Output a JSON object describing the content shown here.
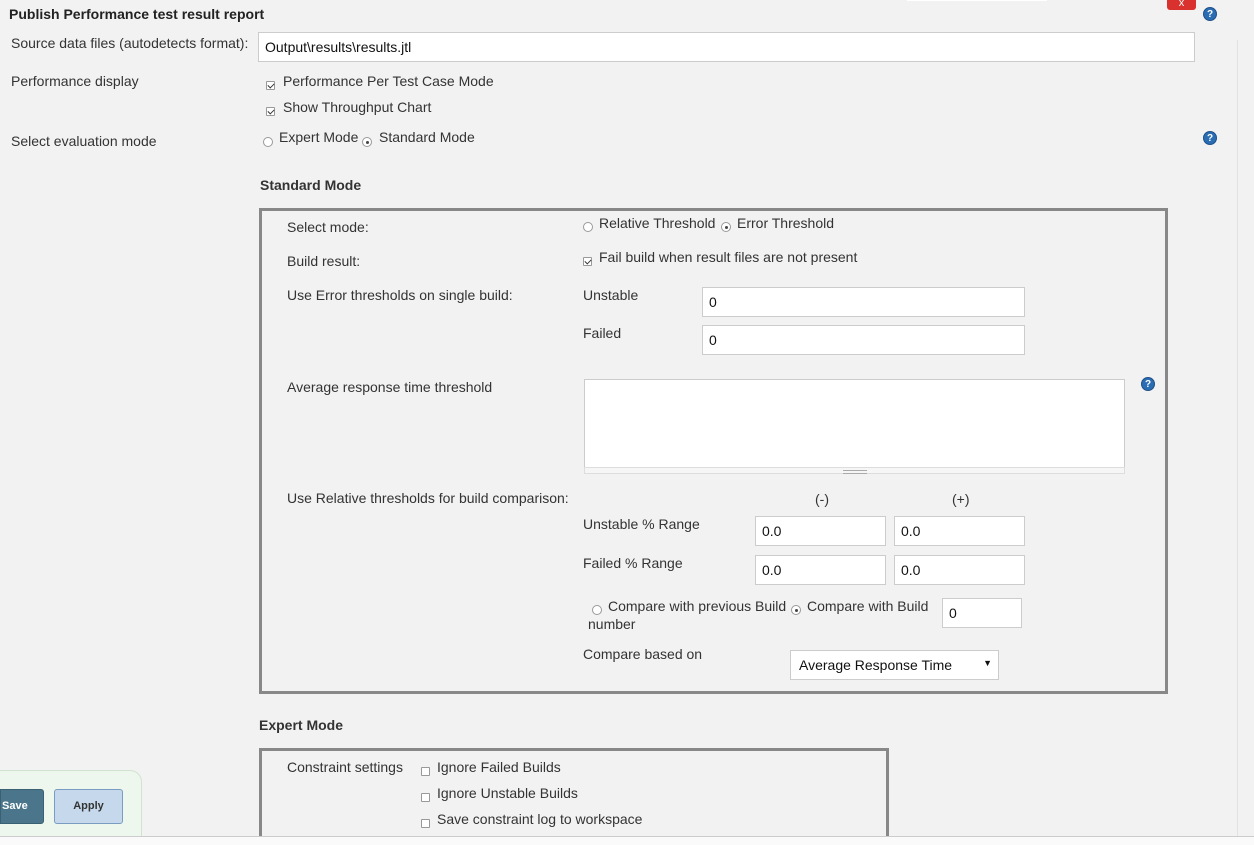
{
  "header": {
    "title": "Publish Performance test result report",
    "close_label": "x"
  },
  "source": {
    "label": "Source data files (autodetects format):",
    "value": "Output\\results\\results.jtl"
  },
  "display": {
    "label": "Performance display",
    "per_test_case": "Performance Per Test Case Mode",
    "throughput_chart": "Show Throughput Chart"
  },
  "evaluation": {
    "label": "Select evaluation mode",
    "expert": "Expert Mode",
    "standard": "Standard Mode",
    "selected": "standard"
  },
  "standard": {
    "heading": "Standard Mode",
    "select_mode_label": "Select mode:",
    "relative": "Relative Threshold",
    "error": "Error Threshold",
    "build_result_label": "Build result:",
    "fail_build": "Fail build when result files are not present",
    "error_thresholds_label": "Use Error thresholds on single build:",
    "unstable_label": "Unstable",
    "unstable_value": "0",
    "failed_label": "Failed",
    "failed_value": "0",
    "avg_response_label": "Average response time threshold",
    "avg_response_value": "",
    "relative_label": "Use Relative thresholds for build comparison:",
    "minus_header": "(-)",
    "plus_header": "(+)",
    "unstable_range_label": "Unstable % Range",
    "unstable_minus": "0.0",
    "unstable_plus": "0.0",
    "failed_range_label": "Failed % Range",
    "failed_minus": "0.0",
    "failed_plus": "0.0",
    "compare_previous": "Compare with previous Build",
    "compare_number_suffix": "number",
    "compare_build": "Compare with Build",
    "compare_build_value": "0",
    "compare_based_label": "Compare based on",
    "compare_based_value": "Average Response Time"
  },
  "expert": {
    "heading": "Expert Mode",
    "constraint_label": "Constraint settings",
    "ignore_failed": "Ignore Failed Builds",
    "ignore_unstable": "Ignore Unstable Builds",
    "save_log": "Save constraint log to workspace"
  },
  "actions": {
    "save": "Save",
    "apply": "Apply"
  },
  "colors": {
    "help": "#2a6db3",
    "close": "#d9322e",
    "save": "#4b758b",
    "apply": "#c6d9ec"
  }
}
